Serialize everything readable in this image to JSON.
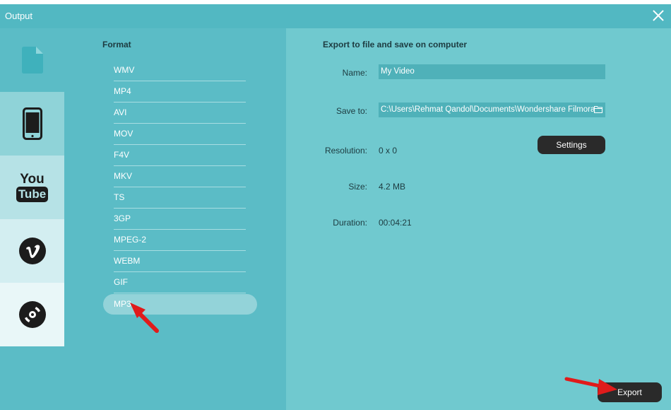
{
  "window": {
    "title": "Output"
  },
  "nav": {
    "items": [
      {
        "icon": "device-file-icon",
        "bg": "#5bbcc6"
      },
      {
        "icon": "smartphone-icon",
        "bg": "#8fd3d8"
      },
      {
        "icon": "youtube-icon",
        "bg": "#b6e2e6",
        "text_top": "You",
        "text_bottom": "Tube"
      },
      {
        "icon": "vimeo-icon",
        "bg": "#d3eef1"
      },
      {
        "icon": "dvd-disc-icon",
        "bg": "#e9f7f8"
      }
    ]
  },
  "format": {
    "heading": "Format",
    "items": [
      "WMV",
      "MP4",
      "AVI",
      "MOV",
      "F4V",
      "MKV",
      "TS",
      "3GP",
      "MPEG-2",
      "WEBM",
      "GIF",
      "MP3"
    ],
    "selected": "MP3"
  },
  "details": {
    "heading": "Export to file and save on computer",
    "name_label": "Name:",
    "name_value": "My Video",
    "saveto_label": "Save to:",
    "saveto_value": "C:\\Users\\Rehmat Qandol\\Documents\\Wondershare Filmora",
    "resolution_label": "Resolution:",
    "resolution_value": "0 x 0",
    "settings_label": "Settings",
    "size_label": "Size:",
    "size_value": "4.2 MB",
    "duration_label": "Duration:",
    "duration_value": "00:04:21"
  },
  "export": {
    "label": "Export"
  },
  "colors": {
    "accent": "#5bbcc6",
    "dark_button": "#2a2a2a",
    "annotation_arrow": "#e01b1b"
  }
}
